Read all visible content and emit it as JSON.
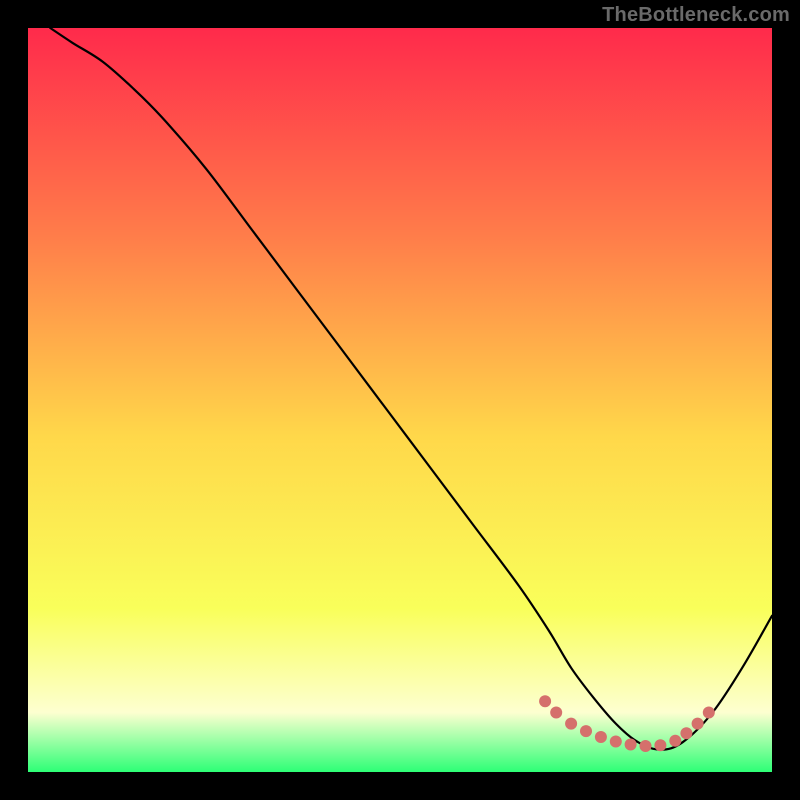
{
  "watermark": "TheBottleneck.com",
  "colors": {
    "frame": "#000000",
    "curve": "#000000",
    "markers": "#d5706c",
    "grad_top": "#ff2a4b",
    "grad_mid1": "#ff7d4a",
    "grad_mid2": "#ffd84a",
    "grad_low1": "#f9ff5a",
    "grad_low2": "#fdffd0",
    "grad_bottom": "#2dff76"
  },
  "chart_data": {
    "type": "line",
    "title": "",
    "xlabel": "",
    "ylabel": "",
    "xlim": [
      0,
      100
    ],
    "ylim": [
      0,
      100
    ],
    "series": [
      {
        "name": "curve",
        "x": [
          3,
          6,
          10,
          14,
          18,
          24,
          30,
          36,
          42,
          48,
          54,
          60,
          66,
          70,
          73,
          76,
          79,
          82,
          85,
          88,
          92,
          96,
          100
        ],
        "y": [
          100,
          98,
          95.5,
          92,
          88,
          81,
          73,
          65,
          57,
          49,
          41,
          33,
          25,
          19,
          14,
          10,
          6.5,
          4,
          3,
          4,
          8,
          14,
          21
        ]
      }
    ],
    "markers": {
      "name": "sweet-spot",
      "x": [
        69.5,
        71,
        73,
        75,
        77,
        79,
        81,
        83,
        85,
        87,
        88.5,
        90,
        91.5
      ],
      "y": [
        9.5,
        8,
        6.5,
        5.5,
        4.7,
        4.1,
        3.7,
        3.5,
        3.6,
        4.2,
        5.2,
        6.5,
        8
      ]
    }
  }
}
